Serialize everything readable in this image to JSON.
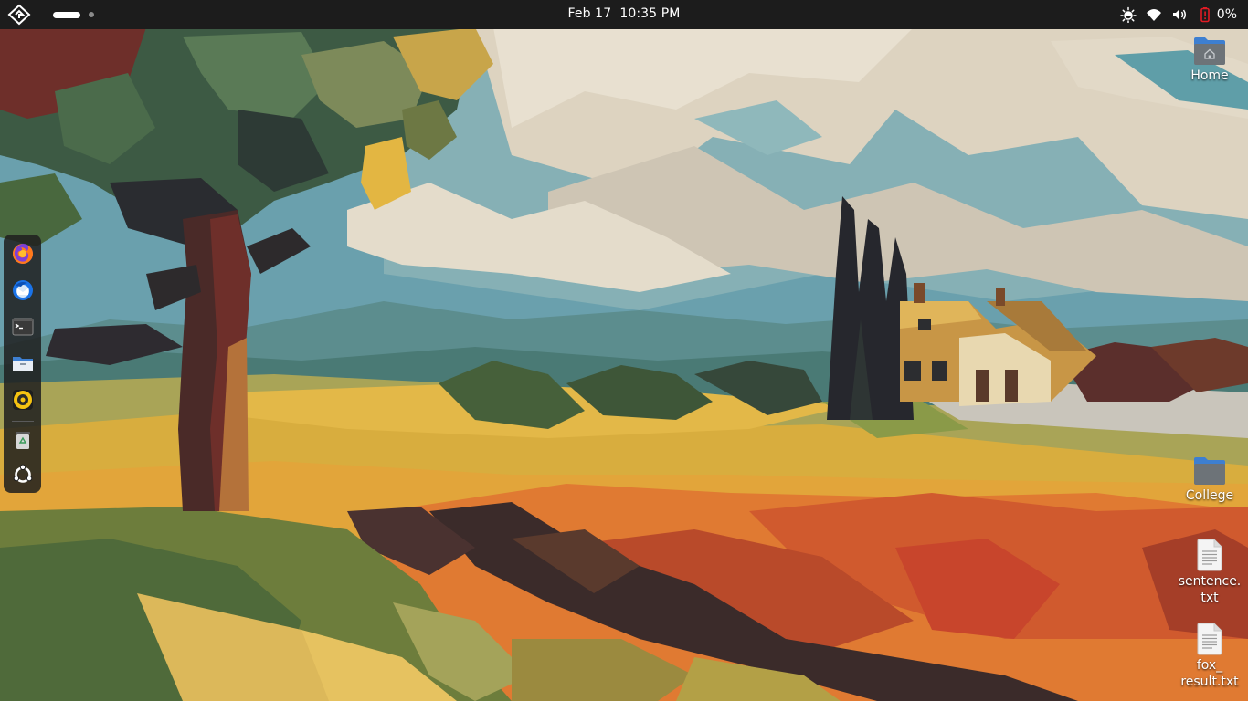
{
  "topbar": {
    "activities_icon": "activities-icon",
    "workspace_count": 2,
    "clock": {
      "date": "Feb 17",
      "time": "10:35 PM"
    },
    "tray": {
      "icons": [
        "night-light-icon",
        "wifi-icon",
        "volume-icon",
        "battery-empty-icon"
      ],
      "battery_text": "0%",
      "battery_color": "#e01b24"
    }
  },
  "dock": {
    "apps": [
      {
        "name": "firefox",
        "icon": "firefox-icon"
      },
      {
        "name": "thunderbird",
        "icon": "thunderbird-icon"
      },
      {
        "name": "terminal",
        "icon": "terminal-icon"
      },
      {
        "name": "files",
        "icon": "files-icon"
      },
      {
        "name": "rhythmbox",
        "icon": "rhythmbox-icon"
      },
      {
        "name": "trash",
        "icon": "trash-icon"
      },
      {
        "name": "show-apps",
        "icon": "ubuntu-apps-icon"
      }
    ]
  },
  "desktop": {
    "home": {
      "label": "Home",
      "icon": "home-folder-icon"
    },
    "college": {
      "label": "College",
      "icon": "folder-icon"
    },
    "sentence": {
      "label_line1": "sentence.",
      "label_line2": "txt",
      "icon": "text-file-icon"
    },
    "fox_result": {
      "label_line1": "fox_",
      "label_line2": "result.txt",
      "icon": "text-file-icon"
    }
  },
  "colors": {
    "topbar_bg": "#1c1c1c",
    "dock_bg": "#1e1e1e",
    "folder_blue": "#3d7fd1",
    "folder_grey": "#6d7378",
    "sky": "#6aa0ad",
    "cloud": "#ddd3c0"
  }
}
